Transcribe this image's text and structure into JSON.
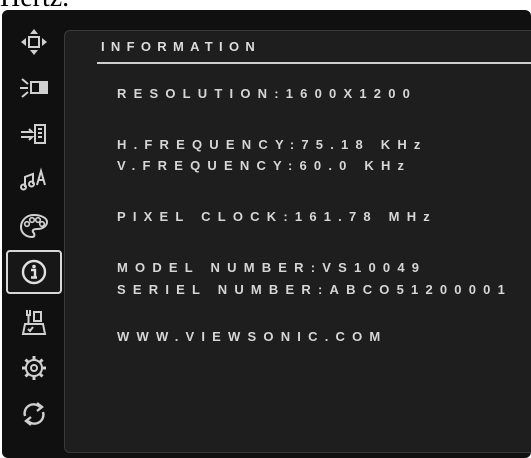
{
  "caption": "Hertz.",
  "menu": {
    "icons": [
      {
        "name": "input-select-icon"
      },
      {
        "name": "brightness-contrast-icon"
      },
      {
        "name": "video-input-icon"
      },
      {
        "name": "audio-icon"
      },
      {
        "name": "color-adjust-icon"
      },
      {
        "name": "information-icon",
        "active": true
      },
      {
        "name": "manual-adjust-icon"
      },
      {
        "name": "setup-menu-icon"
      },
      {
        "name": "memory-recall-icon"
      }
    ]
  },
  "panel": {
    "title": "INFORMATION",
    "lines": {
      "resolution": "RESOLUTION:1600X1200",
      "h_frequency": "H.FREQUENCY:75.18 KHz",
      "v_frequency": "V.FREQUENCY:60.0  KHz",
      "pixel_clock": "PIXEL CLOCK:161.78 MHz",
      "model_number": "MODEL NUMBER:VS10049",
      "serial_number": "SERIEL NUMBER:ABCO51200001",
      "website": "WWW.VIEWSONIC.COM"
    }
  },
  "colors": {
    "background": "#101010",
    "panel": "#1e1e1e",
    "text": "#d6d6d6",
    "active_border": "#d8d8d8"
  }
}
